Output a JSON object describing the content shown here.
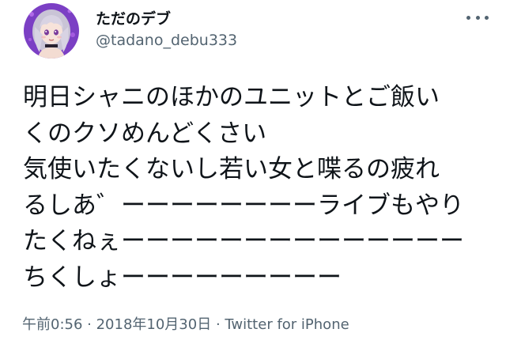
{
  "user": {
    "display_name": "ただのデブ",
    "handle": "@tadano_debu333",
    "avatar_icon": "anime-girl-avatar",
    "avatar_bg": "#7b3fc4"
  },
  "more_icon": "more-horizontal-icon",
  "tweet": {
    "lines": [
      "明日シャニのほかのユニットとご飯い",
      "くのクソめんどくさい",
      "気使いたくないし若い女と喋るの疲れ",
      "るしあ゛ーーーーーーーーライブもやり",
      "たくねぇーーーーーーーーーーーーーー",
      "ちくしょーーーーーーーーー"
    ]
  },
  "meta": {
    "time": "午前0:56",
    "separator": " · ",
    "date": "2018年10月30日",
    "source": "Twitter for iPhone"
  },
  "colors": {
    "text": "#0f1419",
    "secondary": "#536471"
  }
}
